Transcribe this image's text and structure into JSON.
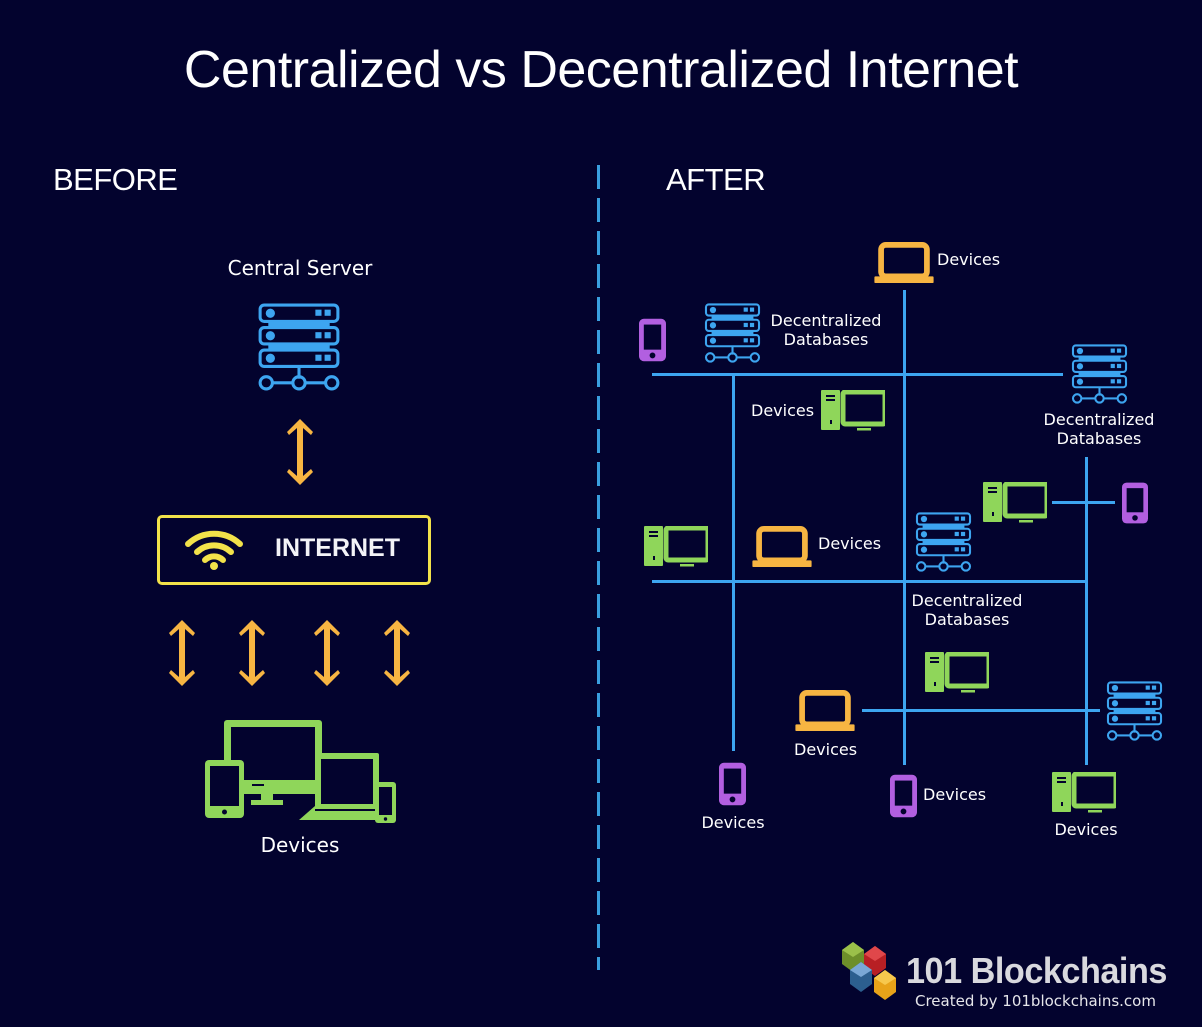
{
  "title": "Centralized vs Decentralized Internet",
  "colors": {
    "background": "#03032e",
    "network_line": "#3da5f0",
    "server": "#3da5f0",
    "arrow": "#f7b542",
    "internet_border": "#f2e24a",
    "wifi": "#f2e24a",
    "devices_green": "#8fd65a",
    "laptop_orange": "#f7b542",
    "phone_purple": "#b25fe0"
  },
  "before": {
    "label": "BEFORE",
    "central_server_label": "Central Server",
    "internet_label": "INTERNET",
    "devices_label": "Devices",
    "icons": [
      "server-icon",
      "double-arrow-icon",
      "wifi-icon",
      "devices-group-icon"
    ]
  },
  "after": {
    "label": "AFTER",
    "nodes": [
      {
        "type": "laptop",
        "label": "Devices"
      },
      {
        "type": "phone",
        "label": ""
      },
      {
        "type": "database",
        "label": "Decentralized Databases"
      },
      {
        "type": "database",
        "label": "Decentralized Databases"
      },
      {
        "type": "desktop",
        "label": "Devices"
      },
      {
        "type": "desktop",
        "label": ""
      },
      {
        "type": "phone",
        "label": ""
      },
      {
        "type": "desktop",
        "label": ""
      },
      {
        "type": "laptop",
        "label": "Devices"
      },
      {
        "type": "database",
        "label": "Decentralized Databases"
      },
      {
        "type": "desktop",
        "label": ""
      },
      {
        "type": "laptop",
        "label": "Devices"
      },
      {
        "type": "database",
        "label": ""
      },
      {
        "type": "phone",
        "label": "Devices"
      },
      {
        "type": "phone",
        "label": "Devices"
      },
      {
        "type": "desktop",
        "label": "Devices"
      }
    ],
    "labels": {
      "devices": "Devices",
      "db_line1": "Decentralized",
      "db_line2": "Databases"
    }
  },
  "branding": {
    "name": "101 Blockchains",
    "credit": "Created by 101blockchains.com"
  }
}
